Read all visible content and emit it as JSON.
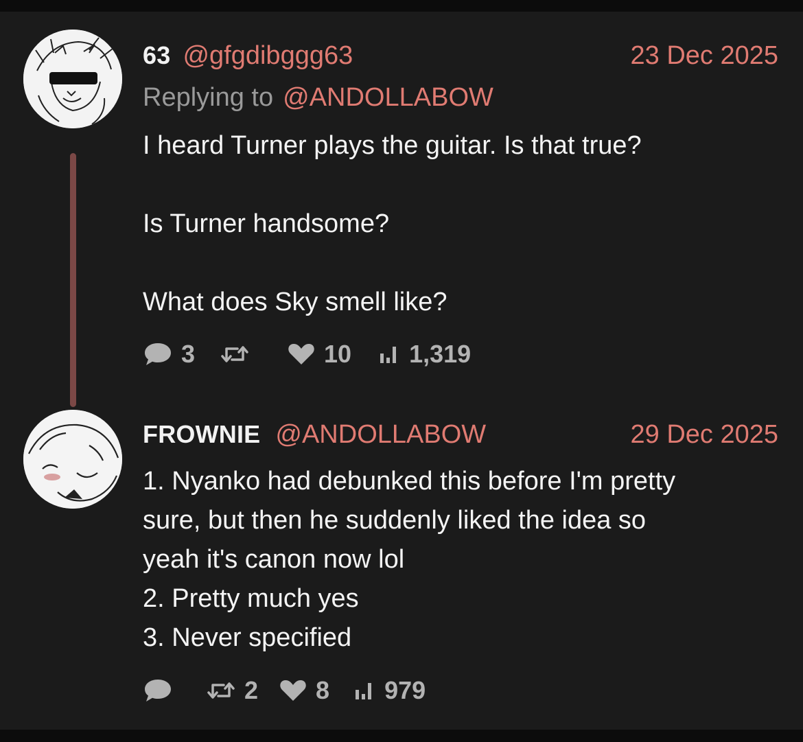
{
  "colors": {
    "background": "#1b1b1b",
    "accent": "#e07b72",
    "text": "#f4f4f4",
    "muted": "#9a9a9a",
    "thread_line": "#7b4846"
  },
  "posts": [
    {
      "display_name": "63",
      "handle": "@gfgdibggg63",
      "date": "23 Dec 2025",
      "replying_label": "Replying to",
      "replying_handle": "@ANDOLLABOW",
      "text": "I heard Turner plays the guitar. Is that true?\n\nIs Turner handsome?\n\nWhat does Sky smell like?",
      "stats": {
        "replies": "3",
        "reposts": "",
        "likes": "10",
        "views": "1,319"
      },
      "icons": [
        "comment-icon",
        "repost-icon",
        "heart-icon",
        "views-icon"
      ]
    },
    {
      "display_name": "FROWNIE",
      "handle": "@ANDOLLABOW",
      "date": "29 Dec 2025",
      "text": "1. Nyanko had debunked this before I'm pretty\nsure, but then he suddenly liked the idea so\nyeah it's canon now lol\n2. Pretty much yes\n3. Never specified",
      "stats": {
        "replies": "",
        "reposts": "2",
        "likes": "8",
        "views": "979"
      },
      "icons": [
        "comment-icon",
        "repost-icon",
        "heart-icon",
        "views-icon"
      ]
    }
  ]
}
